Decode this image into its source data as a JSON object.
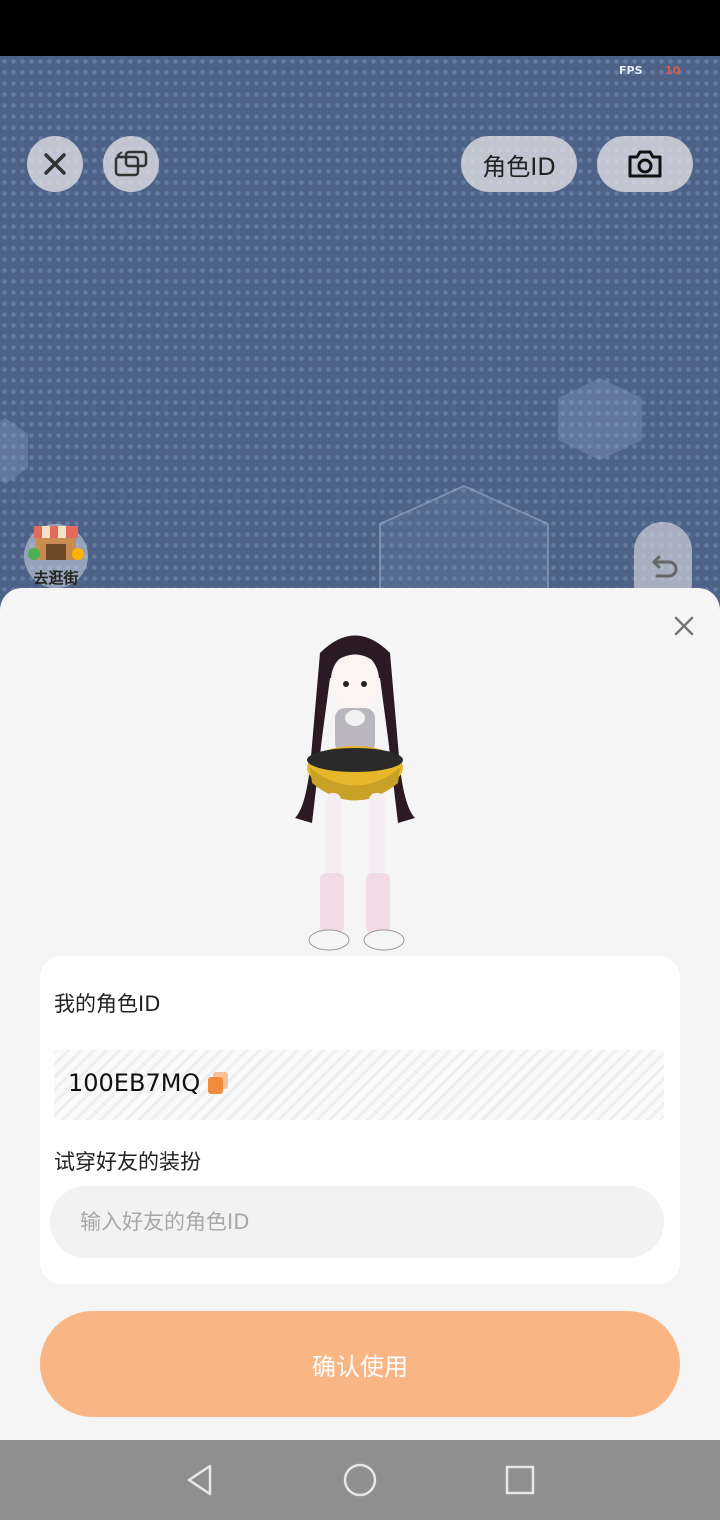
{
  "fps": {
    "label": "FPS",
    "value": "10"
  },
  "topbar": {
    "role_id_button": "角色ID"
  },
  "shop": {
    "label": "去逛街"
  },
  "sheet": {
    "my_role_id_label": "我的角色ID",
    "my_role_id_value": "100EB7MQ",
    "try_friend_label": "试穿好友的装扮",
    "friend_input_placeholder": "输入好友的角色ID",
    "confirm_label": "确认使用"
  },
  "colors": {
    "accent": "#f9b583",
    "scene_bg": "#4e6287",
    "copy_icon": "#f08a3c"
  }
}
